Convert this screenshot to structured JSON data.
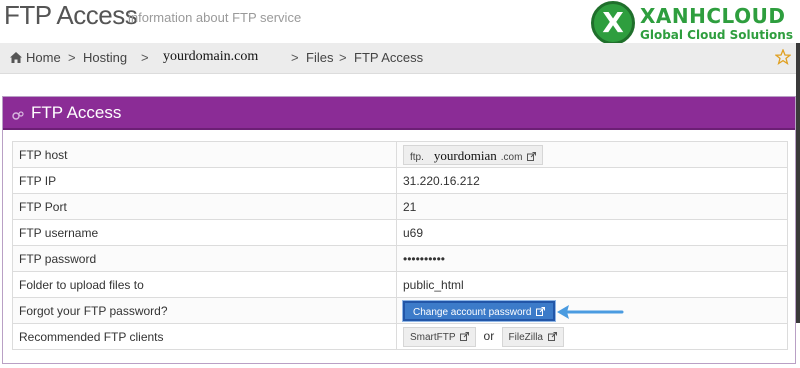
{
  "header": {
    "title": "FTP Access",
    "subtitle": "information about FTP service"
  },
  "logo": {
    "mark": "X",
    "name": "XANHCLOUD",
    "tagline": "Global Cloud Solutions"
  },
  "breadcrumb": {
    "home": "Home",
    "hosting": "Hosting",
    "domain": "yourdomain.com",
    "files": "Files",
    "current": "FTP Access",
    "separator": ">"
  },
  "panel": {
    "title": "FTP Access"
  },
  "rows": {
    "host": {
      "label": "FTP host",
      "prefix": "ftp.",
      "domain": "yourdomian",
      "suffix": ".com"
    },
    "ip": {
      "label": "FTP IP",
      "value": "31.220.16.212"
    },
    "port": {
      "label": "FTP Port",
      "value": "21"
    },
    "username": {
      "label": "FTP username",
      "value": "u69"
    },
    "password": {
      "label": "FTP password",
      "value": "••••••••••"
    },
    "folder": {
      "label": "Folder to upload files to",
      "value": "public_html"
    },
    "forgot": {
      "label": "Forgot your FTP password?",
      "button": "Change account password"
    },
    "clients": {
      "label": "Recommended FTP clients",
      "client1": "SmartFTP",
      "or": "or",
      "client2": "FileZilla"
    }
  },
  "colors": {
    "panel_header": "#8b2c96",
    "button": "#3c7bc9",
    "logo_green": "#2e9e3e",
    "arrow": "#4a9be0"
  },
  "icons": [
    "home-icon",
    "gear-icon",
    "star-icon",
    "external-link-icon",
    "arrow-icon"
  ]
}
